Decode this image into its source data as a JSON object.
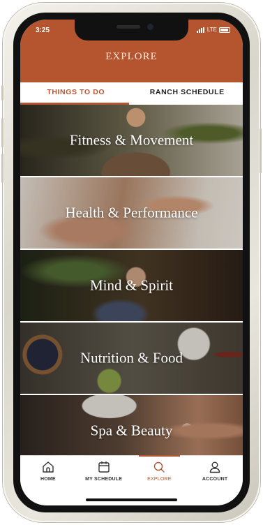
{
  "status_bar": {
    "time": "3:25"
  },
  "header": {
    "title": "EXPLORE"
  },
  "tabs": [
    {
      "label": "THINGS TO DO",
      "active": true
    },
    {
      "label": "RANCH SCHEDULE",
      "active": false
    }
  ],
  "categories": [
    {
      "label": "Fitness & Movement"
    },
    {
      "label": "Health & Performance"
    },
    {
      "label": "Mind & Spirit"
    },
    {
      "label": "Nutrition & Food"
    },
    {
      "label": "Spa & Beauty"
    }
  ],
  "tabbar": [
    {
      "label": "HOME",
      "icon": "home-icon",
      "active": false
    },
    {
      "label": "MY SCHEDULE",
      "icon": "calendar-icon",
      "active": false
    },
    {
      "label": "EXPLORE",
      "icon": "search-icon",
      "active": true
    },
    {
      "label": "ACCOUNT",
      "icon": "user-icon",
      "active": false
    }
  ],
  "colors": {
    "accent": "#b5552f",
    "header_text": "#fbe9df",
    "tab_text": "#222222"
  }
}
